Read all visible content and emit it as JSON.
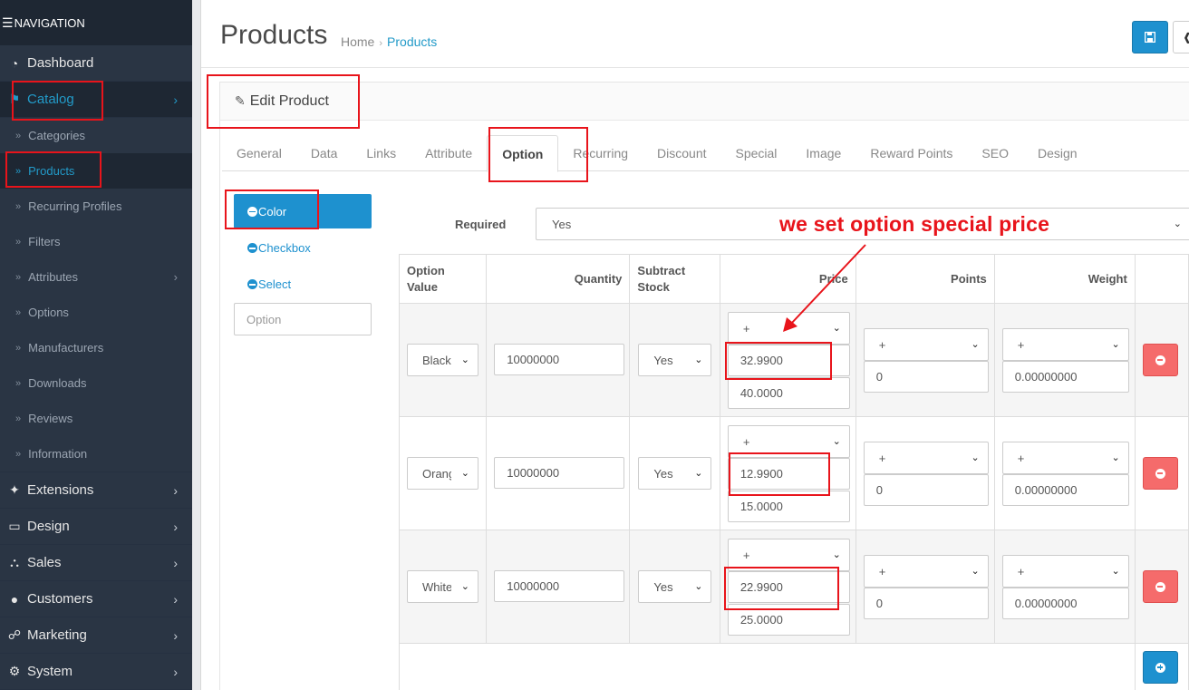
{
  "nav": {
    "header": "NAVIGATION",
    "items_top": [
      {
        "label": "Dashboard",
        "icon": "dashboard-icon"
      },
      {
        "label": "Catalog",
        "icon": "tag-icon",
        "active": true
      }
    ],
    "catalog_sub": [
      "Categories",
      "Products",
      "Recurring Profiles",
      "Filters",
      "Attributes",
      "Options",
      "Manufacturers",
      "Downloads",
      "Reviews",
      "Information"
    ],
    "items_bottom": [
      {
        "label": "Extensions",
        "icon": "puzzle-icon"
      },
      {
        "label": "Design",
        "icon": "desktop-icon"
      },
      {
        "label": "Sales",
        "icon": "cart-icon"
      },
      {
        "label": "Customers",
        "icon": "user-icon"
      },
      {
        "label": "Marketing",
        "icon": "share-icon"
      },
      {
        "label": "System",
        "icon": "gear-icon"
      }
    ]
  },
  "header": {
    "title": "Products",
    "breadcrumb": [
      "Home",
      "Products"
    ]
  },
  "panel": {
    "title": "Edit Product"
  },
  "tabs": [
    "General",
    "Data",
    "Links",
    "Attribute",
    "Option",
    "Recurring",
    "Discount",
    "Special",
    "Image",
    "Reward Points",
    "SEO",
    "Design"
  ],
  "active_tab": "Option",
  "option_list": {
    "items": [
      "Color",
      "Checkbox",
      "Select"
    ],
    "input_placeholder": "Option"
  },
  "required": {
    "label": "Required",
    "value": "Yes"
  },
  "annotation": "we set option special price",
  "table": {
    "headers": {
      "option_value": "Option Value",
      "quantity": "Quantity",
      "subtract": "Subtract Stock",
      "price": "Price",
      "points": "Points",
      "weight": "Weight"
    },
    "rows": [
      {
        "option_value": "Black",
        "quantity": "10000000",
        "subtract": "Yes",
        "price_prefix": "+",
        "price": "32.9900",
        "special_price": "40.0000",
        "points_prefix": "+",
        "points": "0",
        "weight_prefix": "+",
        "weight": "0.00000000"
      },
      {
        "option_value": "Orange",
        "quantity": "10000000",
        "subtract": "Yes",
        "price_prefix": "+",
        "price": "12.9900",
        "special_price": "15.0000",
        "points_prefix": "+",
        "points": "0",
        "weight_prefix": "+",
        "weight": "0.00000000"
      },
      {
        "option_value": "White",
        "quantity": "10000000",
        "subtract": "Yes",
        "price_prefix": "+",
        "price": "22.9900",
        "special_price": "25.0000",
        "points_prefix": "+",
        "points": "0",
        "weight_prefix": "+",
        "weight": "0.00000000"
      }
    ]
  },
  "colors": {
    "sidebar_bg": "#2a3544",
    "accent": "#1e91cf",
    "danger": "#f56b6b",
    "annotation": "#e8141b"
  }
}
